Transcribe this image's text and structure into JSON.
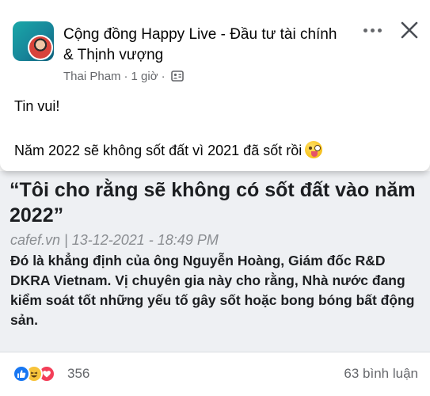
{
  "post": {
    "group_name": "Cộng đồng Happy Live - Đầu tư tài chính & Thịnh vượng",
    "author": "Thai Pham",
    "separator": "·",
    "time": "1 giờ",
    "separator2": "·",
    "privacy_icon": "group-members-icon",
    "text_line1": "Tin vui!",
    "text_line2": "Năm 2022 sẽ không sốt đất vì 2021 đã sốt rồi",
    "emoji": "zany-face-icon"
  },
  "article": {
    "title": "“Tôi cho rằng sẽ không có sốt đất vào năm 2022”",
    "source": "cafef.vn | 13-12-2021 - 18:49 PM",
    "description": "Đó là khẳng định của ông Nguyễn Hoàng, Giám đốc R&D DKRA Vietnam. Vị chuyên gia này cho rằng, Nhà nước đang kiểm soát tốt những yếu tố gây sốt hoặc bong bóng bất động sản."
  },
  "reactions": {
    "icons": [
      "like-icon",
      "haha-icon",
      "love-icon"
    ],
    "count": "356",
    "comments": "63 bình luận"
  },
  "colors": {
    "like": "#1877f2",
    "haha": "#f7c33b",
    "love": "#f33e58",
    "secondary_text": "#65676b",
    "article_bg": "#eef0f3"
  }
}
